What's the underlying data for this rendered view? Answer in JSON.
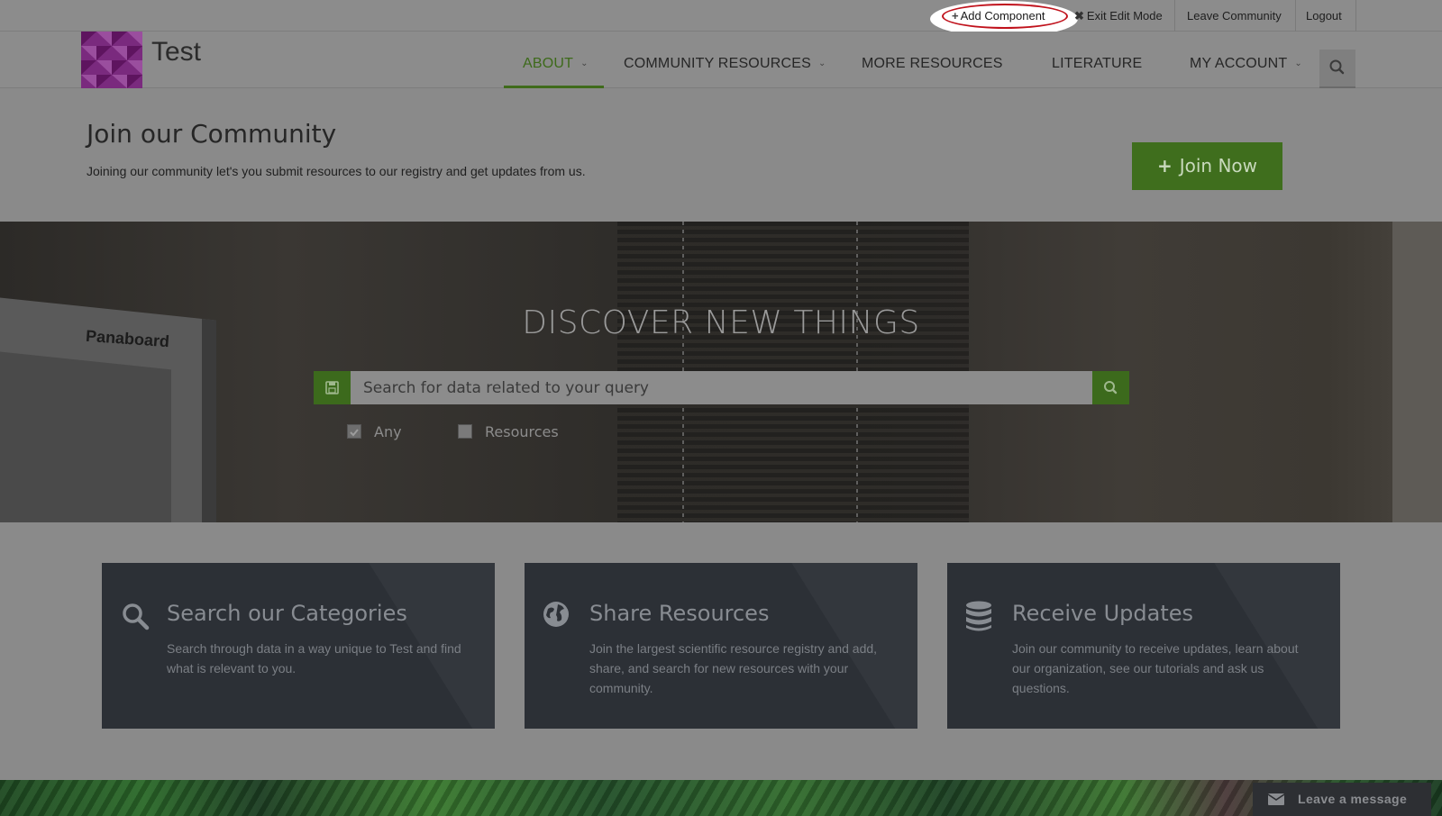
{
  "topbar": {
    "add_component": "Add Component",
    "exit_edit_mode": "Exit Edit Mode",
    "leave_community": "Leave Community",
    "logout": "Logout"
  },
  "header": {
    "brand": "Test",
    "nav": {
      "about": "ABOUT",
      "community_resources": "COMMUNITY RESOURCES",
      "more_resources": "MORE RESOURCES",
      "literature": "LITERATURE",
      "my_account": "MY ACCOUNT"
    },
    "active_nav": "ABOUT"
  },
  "join": {
    "title": "Join our Community",
    "text": "Joining our community let's you submit resources to our registry and get updates from us.",
    "button": "Join Now"
  },
  "hero": {
    "title": "DISCOVER NEW THINGS",
    "board_label": "Panaboard",
    "search_placeholder": "Search for data related to your query",
    "filters": [
      {
        "label": "Any",
        "checked": true
      },
      {
        "label": "Resources",
        "checked": false
      }
    ]
  },
  "cards": [
    {
      "icon": "search-icon",
      "title": "Search our Categories",
      "text": "Search through data in a way unique to Test and find what is relevant to you."
    },
    {
      "icon": "globe-icon",
      "title": "Share Resources",
      "text": "Join the largest scientific resource registry and add, share, and search for new resources with your community."
    },
    {
      "icon": "database-icon",
      "title": "Receive Updates",
      "text": "Join our community to receive updates, learn about our organization, see our tutorials and ask us questions."
    }
  ],
  "chat": {
    "label": "Leave a message"
  },
  "colors": {
    "accent_green": "#3f6e1d",
    "highlight_ring": "#c0121c",
    "card_bg": "#2c3036"
  }
}
